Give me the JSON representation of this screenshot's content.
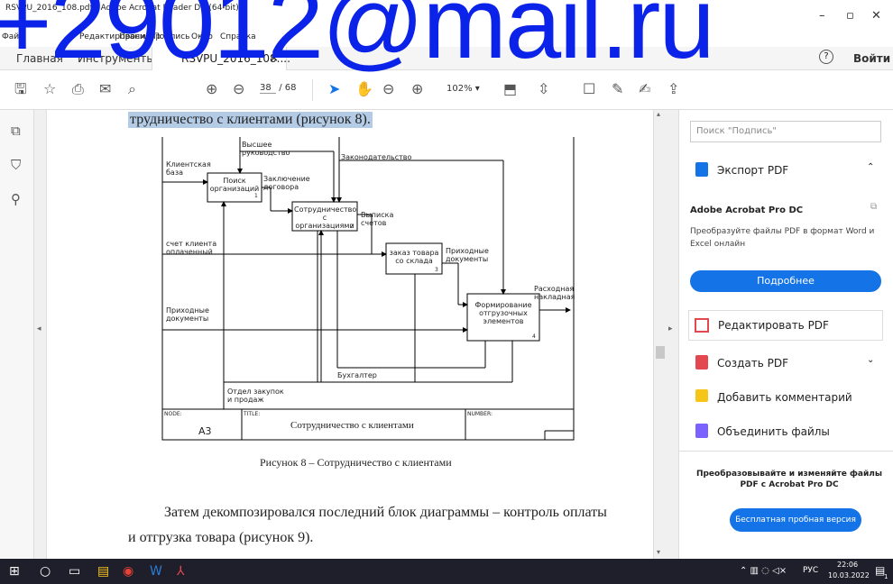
{
  "window": {
    "title": "RSVPU_2016_108.pdf - Adobe Acrobat Reader DC (64-bit)",
    "menu": [
      "Файл",
      "Редактирование",
      "Просмотр",
      "Подпись",
      "Окно",
      "Справка"
    ],
    "watermark": "+29012@mail.ru"
  },
  "tabs": {
    "home": "Главная",
    "tools": "Инструменты",
    "doc": "RSVPU_2016_108....",
    "close": "×",
    "help": "?",
    "signin": "Войти"
  },
  "toolbar": {
    "page_current": "38",
    "page_total": "/ 68",
    "zoom": "102%"
  },
  "document": {
    "line_top": "трудничество с клиентами (рисунок 8).",
    "caption": "Рисунок 8 – Сотрудничество с клиентами",
    "para1": "Затем декомпозировался последний блок диаграммы – контроль оплаты",
    "para2": "и отгрузка товара (рисунок 9)."
  },
  "diagram": {
    "labels": {
      "client_base": "Клиентская база",
      "top_mgmt": "Высшее руководство",
      "law": "Законодательство",
      "contract": "Заключение договора",
      "invoice": "Выписка счетов",
      "paid": "счет клиента оплаченный",
      "income_docs": "Приходные документы",
      "income_docs2": "Приходные документы",
      "out_invoice": "Расходная накладная",
      "accountant": "Бухгалтер",
      "purchase_dept": "Отдел закупок и продаж"
    },
    "boxes": {
      "b1": "Поиск организаций",
      "b2": "Сотрудничество с организациями",
      "b3": "заказ товара со склада",
      "b4": "Формирование отгрузочных элементов"
    },
    "box_nums": {
      "b1": "1",
      "b2": "2",
      "b3": "3",
      "b4": "4"
    },
    "footer": {
      "node_label": "NODE:",
      "title_label": "TITLE:",
      "number_label": "NUMBER:",
      "node": "A3",
      "title": "Сотрудничество с клиентами"
    }
  },
  "right_panel": {
    "search_placeholder": "Поиск \"Подпись\"",
    "export_pdf": "Экспорт PDF",
    "product": "Adobe Acrobat Pro DC",
    "desc": "Преобразуйте файлы PDF в формат Word и Excel онлайн",
    "more_btn": "Подробнее",
    "edit_pdf": "Редактировать PDF",
    "create_pdf": "Создать PDF",
    "add_comment": "Добавить комментарий",
    "combine": "Объединить файлы",
    "promo": "Преобразовывайте и изменяйте файлы PDF с Acrobat Pro DC",
    "trial_btn": "Бесплатная пробная версия"
  },
  "taskbar": {
    "lang": "РУС",
    "time": "22:06",
    "date": "10.03.2022",
    "notif": "1"
  },
  "colors": {
    "accent": "#1473e6",
    "watermark": "#0b22e8",
    "taskbar": "#1f1f2b",
    "highlight": "#b4cbe6"
  }
}
